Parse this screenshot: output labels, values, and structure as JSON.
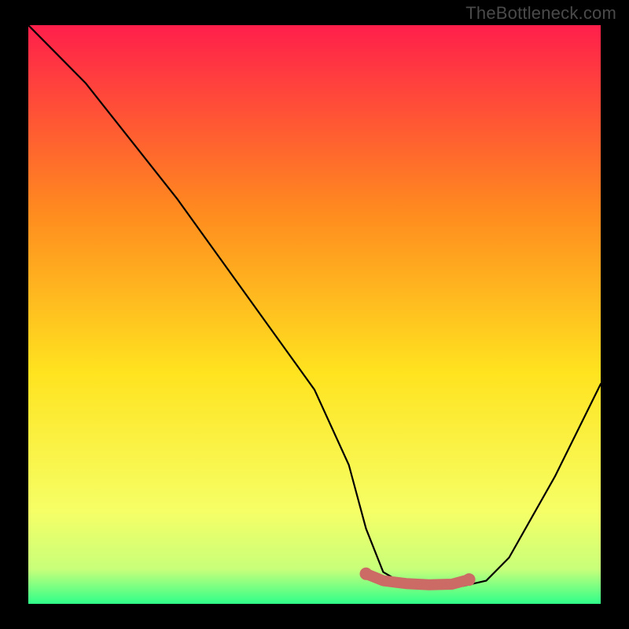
{
  "watermark": "TheBottleneck.com",
  "colors": {
    "background": "#000000",
    "gradient_top": "#ff1f4b",
    "gradient_upper_mid": "#ff8a1f",
    "gradient_mid": "#ffe31f",
    "gradient_lower": "#f6ff66",
    "gradient_near_bottom": "#c8ff7a",
    "gradient_bottom": "#2fff8a",
    "curve": "#000000",
    "marker": "#cc6a65",
    "watermark": "#4a4a4a"
  },
  "chart_data": {
    "type": "line",
    "title": "",
    "xlabel": "",
    "ylabel": "",
    "xlim": [
      0,
      100
    ],
    "ylim": [
      0,
      100
    ],
    "grid": false,
    "legend": false,
    "series": [
      {
        "name": "bottleneck-curve",
        "x": [
          0,
          4,
          10,
          18,
          26,
          34,
          42,
          50,
          56,
          59,
          62,
          66,
          70,
          73,
          76,
          80,
          84,
          88,
          92,
          96,
          100
        ],
        "y": [
          100,
          96,
          90,
          80,
          70,
          59,
          48,
          37,
          24,
          13,
          5.5,
          3.2,
          3.0,
          3.0,
          3.1,
          4.0,
          8,
          15,
          22,
          30,
          38
        ]
      }
    ],
    "markers": [
      {
        "name": "flat-region-start",
        "x": 59,
        "y": 5.2
      },
      {
        "name": "flat-region-mid1",
        "x": 62,
        "y": 4.0
      },
      {
        "name": "flat-region-mid2",
        "x": 66,
        "y": 3.5
      },
      {
        "name": "flat-region-mid3",
        "x": 70,
        "y": 3.3
      },
      {
        "name": "flat-region-mid4",
        "x": 74,
        "y": 3.4
      },
      {
        "name": "flat-region-end",
        "x": 77,
        "y": 4.2
      }
    ]
  }
}
